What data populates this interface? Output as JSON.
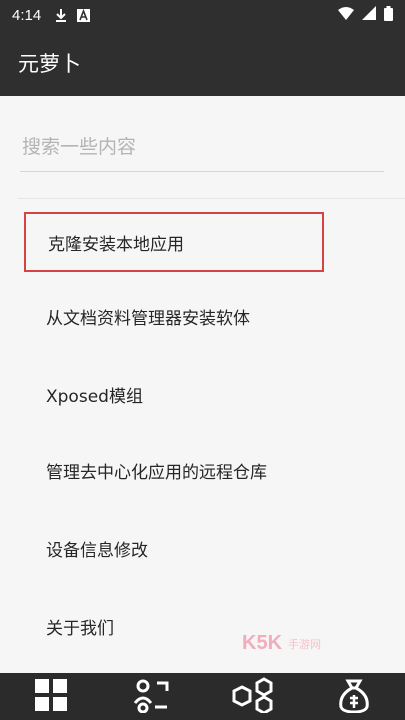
{
  "status_bar": {
    "time": "4:14",
    "icons": [
      "download-icon",
      "notification-a-icon",
      "wifi-icon",
      "signal-icon",
      "battery-icon"
    ]
  },
  "app_bar": {
    "title": "元萝卜"
  },
  "search": {
    "placeholder": "搜索一些内容",
    "value": ""
  },
  "menu": {
    "items": [
      {
        "label": "克隆安装本地应用",
        "highlighted": true
      },
      {
        "label": "从文档资料管理器安装软体"
      },
      {
        "label": "Xposed模组"
      },
      {
        "label": "管理去中心化应用的远程仓库"
      },
      {
        "label": "设备信息修改"
      },
      {
        "label": "关于我们"
      }
    ]
  },
  "watermark": {
    "brand": "K5K",
    "sub": "手游网"
  },
  "bottom_nav": {
    "icons": [
      "grid-apps-icon",
      "contacts-scan-icon",
      "hexagon-modules-icon",
      "money-bag-icon"
    ]
  },
  "colors": {
    "bar_dark": "#2f2f2f",
    "background": "#f6f6f6",
    "highlight_border": "#d64343"
  }
}
